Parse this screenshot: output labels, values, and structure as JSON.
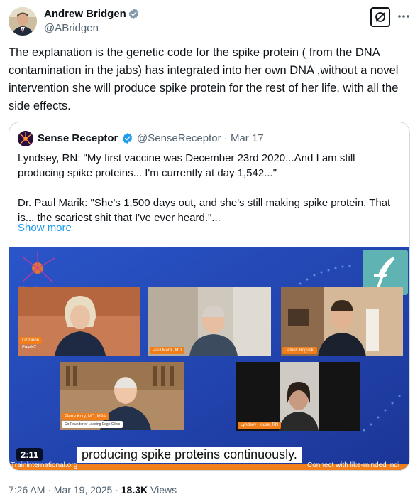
{
  "author": {
    "name": "Andrew Bridgen",
    "handle": "@ABridgen"
  },
  "tweet": {
    "text": "The explanation is the genetic code for the spike protein ( from the DNA contamination in the jabs) has integrated into her own DNA ,without a novel intervention she will produce spike protein for the rest of her life, with all the side effects."
  },
  "quoted": {
    "name": "Sense Receptor",
    "handle": "@SenseReceptor",
    "separator": "·",
    "date": "Mar 17",
    "paragraph1": "Lyndsey, RN: \"My first vaccine was December 23rd 2020...And I am still producing spike proteins... I'm currently at day 1,542...\"",
    "paragraph2": "Dr. Paul Marik: \"She's 1,500 days out, and she's still making spike protein. That is... the scariest shit that I've ever heard.\"...",
    "show_more": "Show more",
    "video": {
      "duration": "2:11",
      "caption": "producing spike proteins continuously.",
      "strip_left": "Traininternational.org",
      "strip_right": "Connect with like-minded indi",
      "watermark": "@SenseReceptor",
      "participants": [
        {
          "name": "Liz Gunn",
          "sub": "FreeNZ"
        },
        {
          "name": "Paul Marik, MD",
          "sub": ""
        },
        {
          "name": "James Roguski",
          "sub": ""
        },
        {
          "name": "Pierre Kory, MD, MPA",
          "sub": "Co-Founder of Leading Edge Clinic"
        },
        {
          "name": "Lyndsey House, RN",
          "sub": ""
        }
      ]
    }
  },
  "footer": {
    "time": "7:26 AM · Mar 19, 2025 · ",
    "views_count": "18.3K",
    "views_label": " Views"
  },
  "colors": {
    "verified": "#1d9bf0",
    "link": "#1d9bf0",
    "video_bg": "#1f3fa8",
    "nametag": "#f07e1b"
  },
  "icons": [
    "verified-badge-icon",
    "grok-icon",
    "more-icon"
  ]
}
